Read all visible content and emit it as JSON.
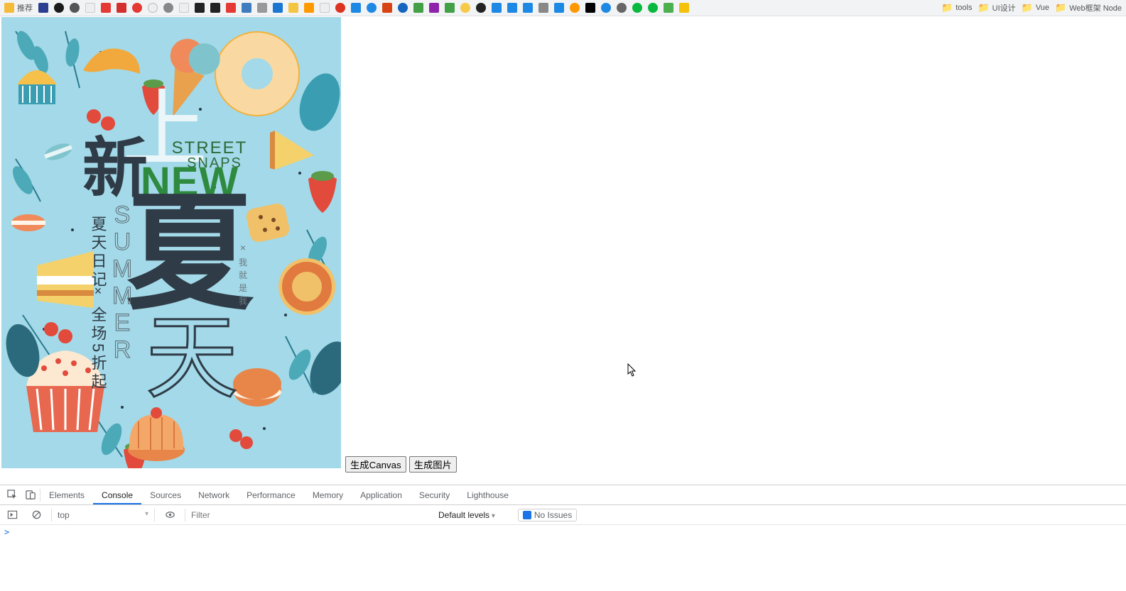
{
  "bookmarks": {
    "first_label": "推荐",
    "folders": [
      {
        "label": "tools"
      },
      {
        "label": "UI设计"
      },
      {
        "label": "Vue"
      },
      {
        "label": "Web框架 Node"
      }
    ]
  },
  "poster": {
    "street": "STREET",
    "snaps": "SNAPS",
    "xin": "新",
    "shang": "上",
    "new_en": "NEW",
    "xia": "夏",
    "tian": "天",
    "summer_letters": [
      "S",
      "U",
      "M",
      "M",
      "E",
      "R"
    ],
    "diary": "夏天日记",
    "sale": "全场5折起",
    "x_mark": "×",
    "tagline_chars": [
      "我",
      "就",
      "是",
      "我"
    ]
  },
  "buttons": {
    "gen_canvas": "生成Canvas",
    "gen_image": "生成图片"
  },
  "devtools": {
    "tabs": [
      "Elements",
      "Console",
      "Sources",
      "Network",
      "Performance",
      "Memory",
      "Application",
      "Security",
      "Lighthouse"
    ],
    "active_tab": 1,
    "context": "top",
    "filter_placeholder": "Filter",
    "levels": "Default levels",
    "issues": "No Issues",
    "prompt": ">"
  }
}
